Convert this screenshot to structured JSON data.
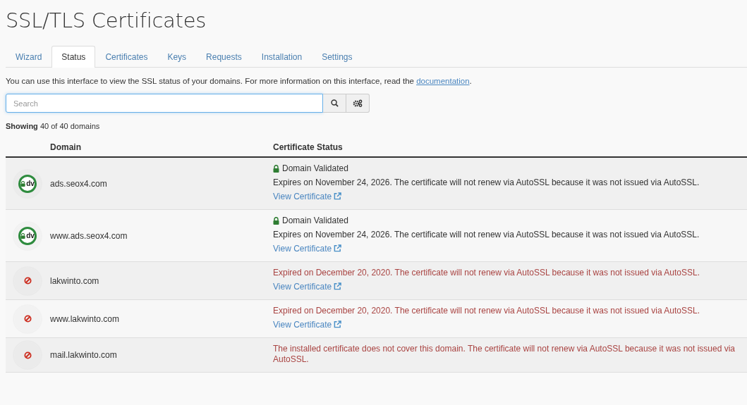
{
  "page": {
    "title": "SSL/TLS Certificates"
  },
  "tabs": [
    {
      "label": "Wizard",
      "selected": false
    },
    {
      "label": "Status",
      "selected": true
    },
    {
      "label": "Certificates",
      "selected": false
    },
    {
      "label": "Keys",
      "selected": false
    },
    {
      "label": "Requests",
      "selected": false
    },
    {
      "label": "Installation",
      "selected": false
    },
    {
      "label": "Settings",
      "selected": false
    }
  ],
  "intro": {
    "text": "You can use this interface to view the SSL status of your domains. For more information on this interface, read the",
    "link": "documentation",
    "end": "."
  },
  "search": {
    "placeholder": "Search"
  },
  "summary": "**Showing** 40 of 40 domains",
  "table": {
    "columns": [
      "Domain",
      "Certificate Status"
    ],
    "rows": [
      {
        "kind": "dv",
        "domain": "ads.seox4.com",
        "badge": "dv",
        "status_label": "Domain Validated",
        "message": "Expires on November 24, 2026. The certificate will not renew via AutoSSL because it was not issued via AutoSSL.",
        "link": "View Certificate"
      },
      {
        "kind": "dv",
        "domain": "www.ads.seox4.com",
        "badge": "dv",
        "status_label": "Domain Validated",
        "message": "Expires on November 24, 2026. The certificate will not renew via AutoSSL because it was not issued via AutoSSL.",
        "link": "View Certificate"
      },
      {
        "kind": "error",
        "domain": "lakwinto.com",
        "message": "Expired on December 20, 2020. The certificate will not renew via AutoSSL because it was not issued via AutoSSL.",
        "link": "View Certificate"
      },
      {
        "kind": "error",
        "domain": "www.lakwinto.com",
        "message": "Expired on December 20, 2020. The certificate will not renew via AutoSSL because it was not issued via AutoSSL.",
        "link": "View Certificate"
      },
      {
        "kind": "error",
        "domain": "mail.lakwinto.com",
        "message": "The installed certificate does not cover this domain. The certificate will not renew via AutoSSL because it was not issued via AutoSSL."
      }
    ]
  }
}
